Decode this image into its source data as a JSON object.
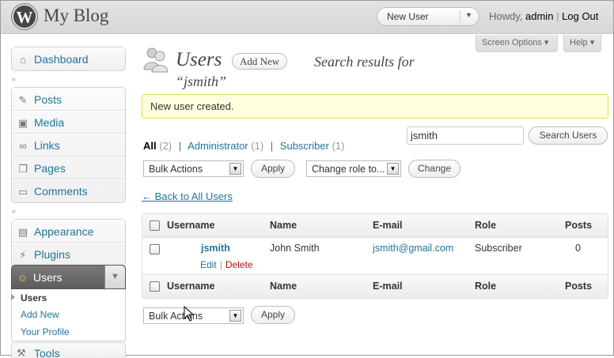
{
  "header": {
    "site_title": "My Blog",
    "logo_letter": "W",
    "favorite_action": "New User",
    "howdy_text": "Howdy,",
    "username": "admin",
    "logout": "Log Out"
  },
  "screen_options": "Screen Options",
  "help": "Help",
  "sidebar": {
    "group1": [
      {
        "label": "Dashboard",
        "icon": "home-icon"
      }
    ],
    "group2": [
      {
        "label": "Posts",
        "icon": "pushpin-icon"
      },
      {
        "label": "Media",
        "icon": "media-icon"
      },
      {
        "label": "Links",
        "icon": "chain-link-icon"
      },
      {
        "label": "Pages",
        "icon": "pages-icon"
      },
      {
        "label": "Comments",
        "icon": "comment-bubble-icon"
      }
    ],
    "group3": [
      {
        "label": "Appearance",
        "icon": "appearance-icon"
      },
      {
        "label": "Plugins",
        "icon": "plug-icon"
      }
    ],
    "users": {
      "label": "Users",
      "icon": "users-icon"
    },
    "users_submenu": [
      "Users",
      "Add New",
      "Your Profile"
    ],
    "tools": {
      "label": "Tools",
      "icon": "wrench-icon"
    }
  },
  "main": {
    "title": "Users",
    "add_new": "Add New",
    "search_results_for": "Search results for",
    "search_term": "“jsmith”",
    "notice": "New user created.",
    "filters": [
      {
        "label": "All",
        "count": "(2)",
        "current": true
      },
      {
        "label": "Administrator",
        "count": "(1)",
        "current": false
      },
      {
        "label": "Subscriber",
        "count": "(1)",
        "current": false
      }
    ],
    "search_value": "jsmith",
    "search_button": "Search Users",
    "bulk_actions": "Bulk Actions",
    "apply": "Apply",
    "change_role": "Change role to...",
    "change": "Change",
    "back_link": "← Back to All Users"
  },
  "table": {
    "columns": [
      "Username",
      "Name",
      "E-mail",
      "Role",
      "Posts"
    ],
    "rows": [
      {
        "username": "jsmith",
        "name": "John Smith",
        "email": "jsmith@gmail.com",
        "role": "Subscriber",
        "posts": "0",
        "actions": {
          "edit": "Edit",
          "delete": "Delete"
        }
      }
    ]
  },
  "colors": {
    "link": "#21759b",
    "notice_bg": "#ffffe0",
    "delete": "#bc0b0b"
  }
}
